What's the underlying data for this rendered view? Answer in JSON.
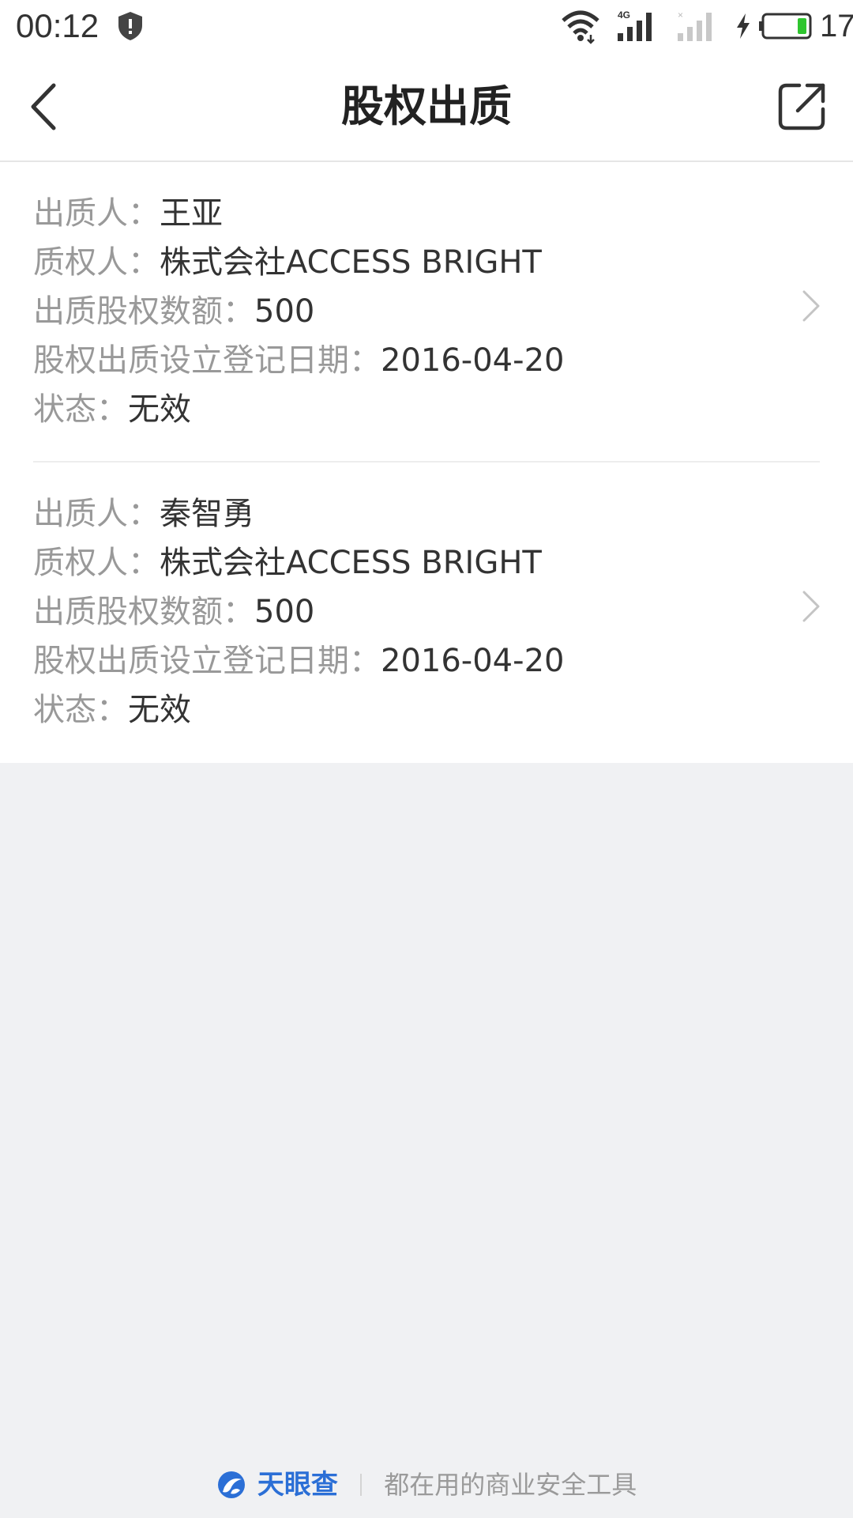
{
  "status_bar": {
    "time": "00:12",
    "battery_percent": "17",
    "network_label": "4G",
    "battery_color": "#2ec52e",
    "icons": [
      "shield-icon",
      "wifi-icon",
      "signal-4g-icon",
      "signal-no-sim-icon",
      "charging-bolt-icon",
      "battery-icon"
    ]
  },
  "header": {
    "title": "股权出质",
    "back_icon": "chevron-left-icon",
    "share_icon": "share-icon"
  },
  "records": [
    {
      "pledgor_label": "出质人：",
      "pledgor": "王亚",
      "pledgee_label": "质权人：",
      "pledgee": "株式会社ACCESS BRIGHT",
      "amount_label": "出质股权数额：",
      "amount": "500",
      "date_label": "股权出质设立登记日期：",
      "date": "2016-04-20",
      "status_label": "状态：",
      "status": "无效"
    },
    {
      "pledgor_label": "出质人：",
      "pledgor": "秦智勇",
      "pledgee_label": "质权人：",
      "pledgee": "株式会社ACCESS BRIGHT",
      "amount_label": "出质股权数额：",
      "amount": "500",
      "date_label": "股权出质设立登记日期：",
      "date": "2016-04-20",
      "status_label": "状态：",
      "status": "无效"
    }
  ],
  "footer": {
    "brand": "天眼查",
    "slogan": "都在用的商业安全工具",
    "brand_color": "#2b6fd6"
  }
}
